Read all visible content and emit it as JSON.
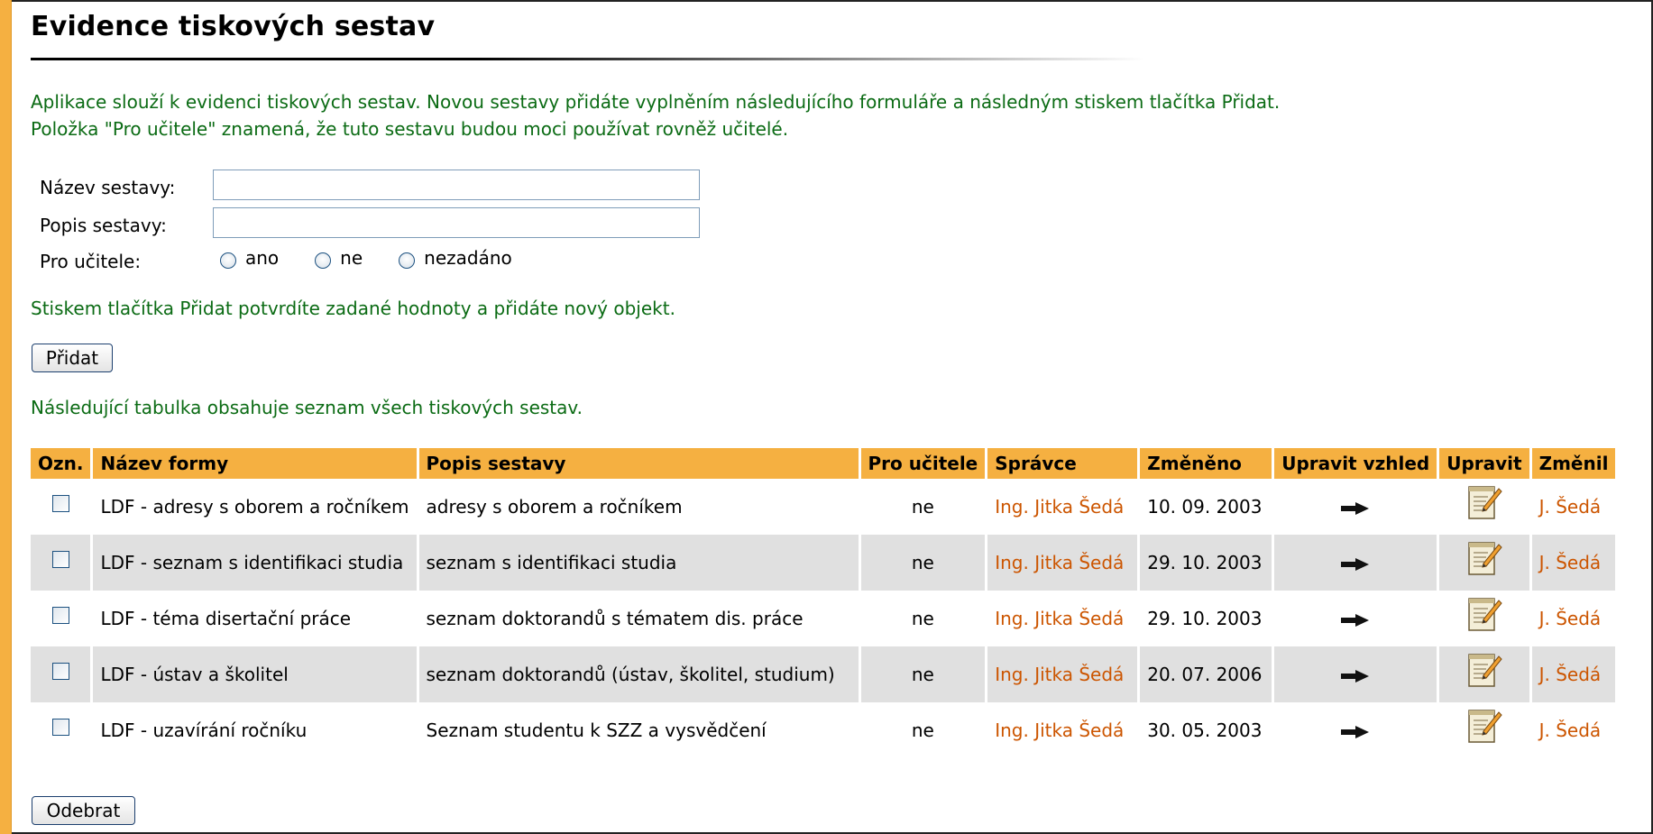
{
  "page": {
    "title": "Evidence tiskových sestav",
    "intro": "Aplikace slouží k evidenci tiskových sestav. Novou sestavy přidáte vyplněním následujícího formuláře a následným stiskem tlačítka Přidat. Položka \"Pro učitele\" znamená, že tuto sestavu budou moci používat rovněž učitelé.",
    "accent_color": "#f5b041",
    "text_green": "#0b6b14",
    "link_color": "#cc5500"
  },
  "form": {
    "name_label": "Název sestavy:",
    "name_value": "",
    "desc_label": "Popis sestavy:",
    "desc_value": "",
    "teacher_label": "Pro učitele:",
    "options": [
      "ano",
      "ne",
      "nezadáno"
    ],
    "selected_option": null
  },
  "confirm_text": "Stiskem tlačítka Přidat potvrdíte zadané hodnoty a přidáte nový objekt.",
  "add_button": "Přidat",
  "table_desc": "Následující tabulka obsahuje seznam všech tiskových sestav.",
  "table": {
    "headers": [
      "Ozn.",
      "Název formy",
      "Popis sestavy",
      "Pro učitele",
      "Správce",
      "Změněno",
      "Upravit vzhled",
      "Upravit",
      "Změnil"
    ],
    "rows": [
      {
        "checked": false,
        "name": "LDF - adresy s oborem a ročníkem",
        "desc": "adresy s oborem a ročníkem",
        "teacher": "ne",
        "admin": "Ing. Jitka Šedá",
        "changed": "10. 09. 2003",
        "changed_by": "J. Šedá"
      },
      {
        "checked": false,
        "name": "LDF - seznam s identifikaci studia",
        "desc": "seznam s identifikaci studia",
        "teacher": "ne",
        "admin": "Ing. Jitka Šedá",
        "changed": "29. 10. 2003",
        "changed_by": "J. Šedá"
      },
      {
        "checked": false,
        "name": "LDF - téma disertační práce",
        "desc": "seznam doktorandů s tématem dis. práce",
        "teacher": "ne",
        "admin": "Ing. Jitka Šedá",
        "changed": "29. 10. 2003",
        "changed_by": "J. Šedá"
      },
      {
        "checked": false,
        "name": "LDF - ústav a školitel",
        "desc": "seznam doktorandů (ústav, školitel, studium)",
        "teacher": "ne",
        "admin": "Ing. Jitka Šedá",
        "changed": "20. 07. 2006",
        "changed_by": "J. Šedá"
      },
      {
        "checked": false,
        "name": "LDF - uzavírání ročníku",
        "desc": "Seznam studentu k SZZ a vysvědčení",
        "teacher": "ne",
        "admin": "Ing. Jitka Šedá",
        "changed": "30. 05. 2003",
        "changed_by": "J. Šedá"
      }
    ],
    "layout_icon": "arrow-right-icon",
    "edit_icon": "edit-document-icon"
  },
  "remove_button": "Odebrat"
}
